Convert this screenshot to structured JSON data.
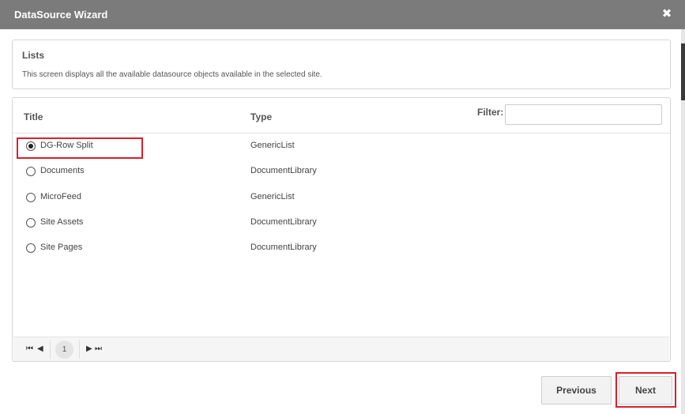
{
  "dialog": {
    "title": "DataSource Wizard",
    "close_glyph": "✖"
  },
  "info": {
    "heading": "Lists",
    "description": "This screen displays all the available datasource objects available in the selected site."
  },
  "table": {
    "columns": {
      "title": "Title",
      "type": "Type"
    },
    "filter": {
      "label": "Filter:",
      "value": "",
      "placeholder": ""
    },
    "rows": [
      {
        "title": "DG-Row Split",
        "type": "GenericList",
        "selected": true
      },
      {
        "title": "Documents",
        "type": "DocumentLibrary",
        "selected": false
      },
      {
        "title": "MicroFeed",
        "type": "GenericList",
        "selected": false
      },
      {
        "title": "Site Assets",
        "type": "DocumentLibrary",
        "selected": false
      },
      {
        "title": "Site Pages",
        "type": "DocumentLibrary",
        "selected": false
      }
    ]
  },
  "pager": {
    "first_glyph": "⏮",
    "prev_glyph": "◀",
    "current_page": "1",
    "next_glyph": "▶",
    "last_glyph": "⏭"
  },
  "footer": {
    "previous_label": "Previous",
    "next_label": "Next"
  },
  "colors": {
    "titlebar": "#7b7b7b",
    "highlight": "#d9202a"
  },
  "icons": {
    "close": "close-icon",
    "first": "first-page-icon",
    "prev": "prev-page-icon",
    "next": "next-page-icon",
    "last": "last-page-icon"
  }
}
